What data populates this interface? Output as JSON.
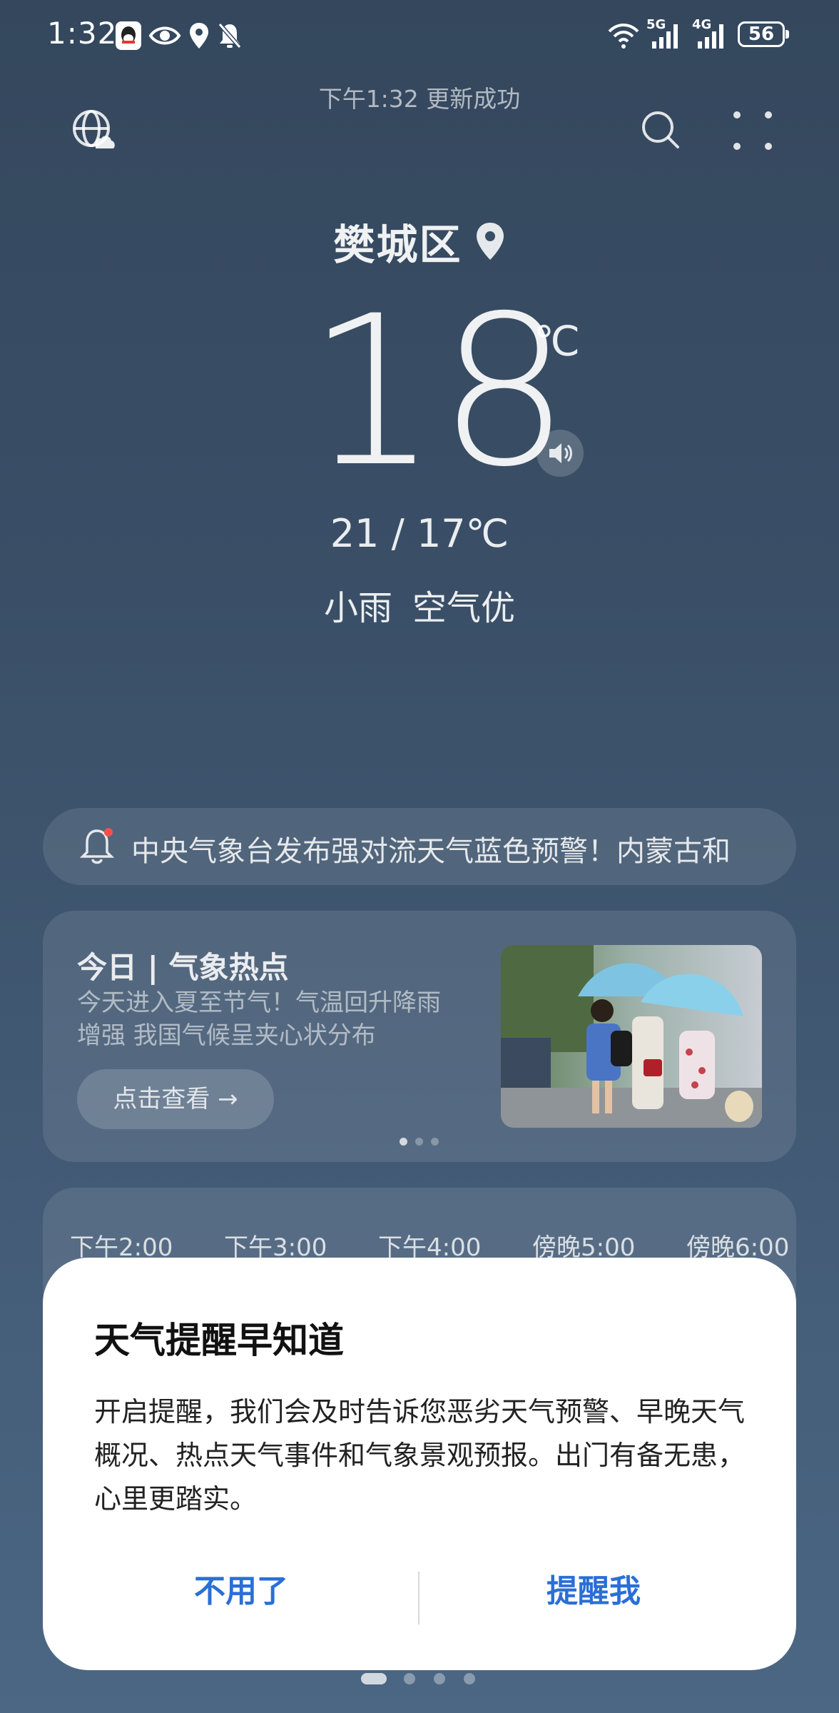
{
  "status_bar": {
    "time": "1:32",
    "battery": "56",
    "network_5g": "5G",
    "network_4g": "4G"
  },
  "update_status": "下午1:32 更新成功",
  "location": {
    "city": "樊城区"
  },
  "weather": {
    "temperature": "18",
    "unit": "℃",
    "range": "21 / 17℃",
    "condition": "小雨",
    "air_quality": "空气优"
  },
  "alert": {
    "text": "中央气象台发布强对流天气蓝色预警！内蒙古和"
  },
  "hot_topic": {
    "title": "今日 | 气象热点",
    "description": "今天进入夏至节气！气温回升降雨增强 我国气候呈夹心状分布",
    "button_label": "点击查看 →",
    "carousel_count": 3,
    "carousel_active": 1
  },
  "hourly": {
    "times": [
      "下午2:00",
      "下午3:00",
      "下午4:00",
      "傍晚5:00",
      "傍晚6:00"
    ]
  },
  "page_indicator": {
    "count": 4,
    "active": 1
  },
  "dialog": {
    "title": "天气提醒早知道",
    "body": "开启提醒，我们会及时告诉您恶劣天气预警、早晚天气概况、热点天气事件和气象景观预报。出门有备无患，心里更踏实。",
    "cancel_label": "不用了",
    "confirm_label": "提醒我",
    "accent_color": "#2a6fd6"
  }
}
